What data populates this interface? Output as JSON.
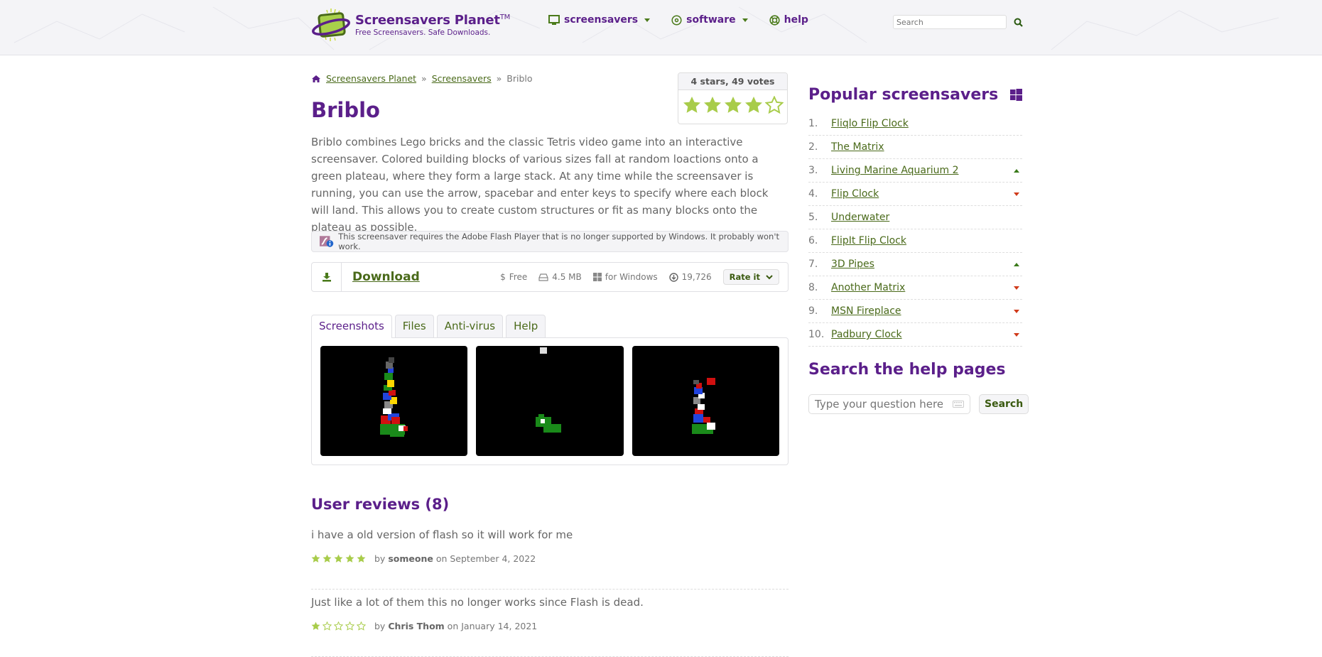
{
  "header": {
    "site_title": "Screensavers Planet",
    "trademark": "TM",
    "tagline": "Free Screensavers. Safe Downloads.",
    "nav": [
      {
        "label": "screensavers",
        "icon": "monitor-icon",
        "has_dropdown": true
      },
      {
        "label": "software",
        "icon": "disc-icon",
        "has_dropdown": true
      },
      {
        "label": "help",
        "icon": "lifebuoy-icon",
        "has_dropdown": false
      }
    ],
    "search_placeholder": "Search"
  },
  "breadcrumb": {
    "home_icon": "home-icon",
    "items": [
      "Screensavers Planet",
      "Screensavers",
      "Briblo"
    ],
    "separator": "»"
  },
  "rating": {
    "summary": "4 stars, 49 votes",
    "stars": 4,
    "max_stars": 5
  },
  "page": {
    "title": "Briblo",
    "description": "Briblo combines Lego bricks and the classic Tetris video game into an interactive screensaver. Colored building blocks of various sizes fall at random loactions onto a green plateau, where they form a large stack. At any time while the screensaver is running, you can use the arrow, spacebar and enter keys to specify where each block will land. This allows you to create custom structures or fit as many blocks onto the plateau as possible.",
    "notice": "This screensaver requires the Adobe Flash Player that is no longer supported by Windows. It probably won't work."
  },
  "download": {
    "label": "Download",
    "price": "Free",
    "size": "4.5 MB",
    "platform": "for Windows",
    "downloads": "19,726",
    "rate_label": "Rate it"
  },
  "tabs": [
    {
      "label": "Screenshots",
      "active": true
    },
    {
      "label": "Files",
      "active": false
    },
    {
      "label": "Anti-virus",
      "active": false
    },
    {
      "label": "Help",
      "active": false
    }
  ],
  "screenshots": [
    "Briblo screenshot 1",
    "Briblo screenshot 2",
    "Briblo screenshot 3"
  ],
  "reviews": {
    "title": "User reviews (8)",
    "items": [
      {
        "text": "i have a old version of flash so it will work for me",
        "stars": 5,
        "by": "by",
        "author": "someone",
        "on": "on",
        "date": "September 4, 2022"
      },
      {
        "text": "Just like a lot of them this no longer works since Flash is dead.",
        "stars": 1,
        "by": "by",
        "author": "Chris Thom",
        "on": "on",
        "date": "January 14, 2021"
      }
    ]
  },
  "sidebar": {
    "popular_title": "Popular screensavers",
    "popular": [
      {
        "rank": "1.",
        "name": "Fliqlo Flip Clock",
        "trend": ""
      },
      {
        "rank": "2.",
        "name": "The Matrix",
        "trend": ""
      },
      {
        "rank": "3.",
        "name": "Living Marine Aquarium 2",
        "trend": "up"
      },
      {
        "rank": "4.",
        "name": "Flip Clock",
        "trend": "down"
      },
      {
        "rank": "5.",
        "name": "Underwater",
        "trend": ""
      },
      {
        "rank": "6.",
        "name": "FlipIt Flip Clock",
        "trend": ""
      },
      {
        "rank": "7.",
        "name": "3D Pipes",
        "trend": "up"
      },
      {
        "rank": "8.",
        "name": "Another Matrix",
        "trend": "down"
      },
      {
        "rank": "9.",
        "name": "MSN Fireplace",
        "trend": "down"
      },
      {
        "rank": "10.",
        "name": "Padbury Clock",
        "trend": "down"
      }
    ],
    "help_title": "Search the help pages",
    "help_placeholder": "Type your question here",
    "help_button": "Search"
  },
  "colors": {
    "brand_purple": "#5b1f8a",
    "link_green": "#4a6a1a",
    "star_green": "#a8cc4a",
    "trend_up": "#3a7a1a",
    "trend_down": "#d03a1a"
  }
}
